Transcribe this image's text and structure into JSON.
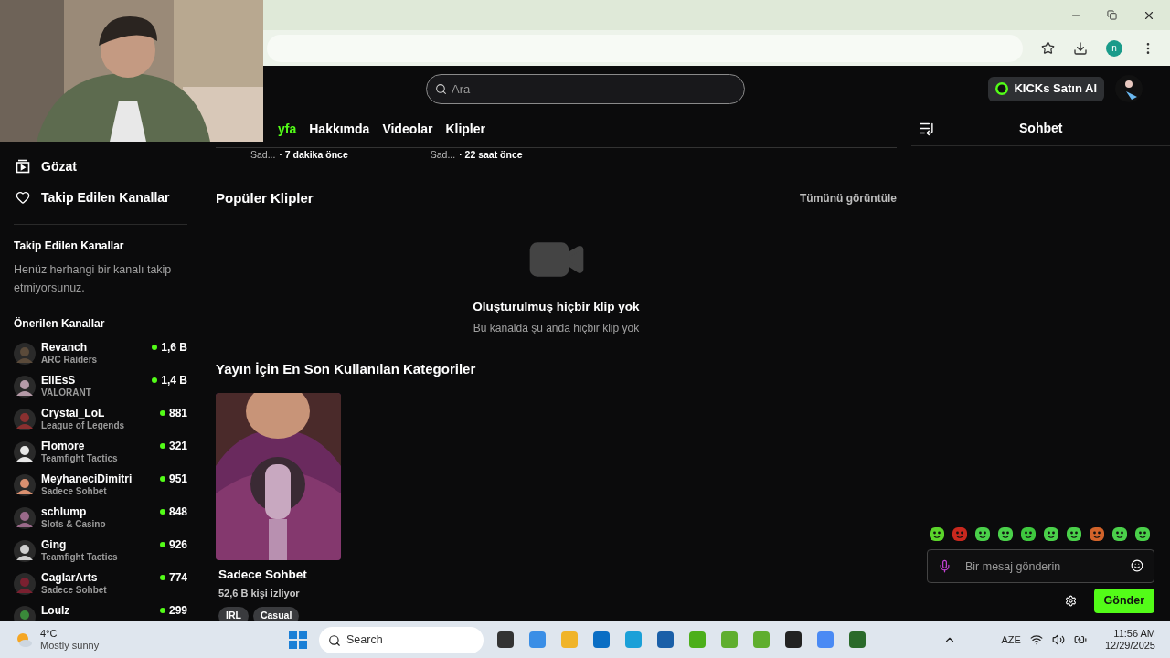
{
  "browser": {
    "profile_initial": "n"
  },
  "header": {
    "search_placeholder": "Ara",
    "buy_button": "KICKs Satın Al"
  },
  "sidebar": {
    "nav": [
      {
        "label": "Gözat"
      },
      {
        "label": "Takip Edilen Kanallar"
      }
    ],
    "followed": {
      "title": "Takip Edilen Kanallar",
      "empty_text": "Henüz herhangi bir kanalı takip etmiyorsunuz."
    },
    "recommended": {
      "title": "Önerilen Kanallar",
      "channels": [
        {
          "name": "Revanch",
          "category": "ARC Raiders",
          "viewers": "1,6 B"
        },
        {
          "name": "EliEsS",
          "category": "VALORANT",
          "viewers": "1,4 B"
        },
        {
          "name": "Crystal_LoL",
          "category": "League of Legends",
          "viewers": "881"
        },
        {
          "name": "Flomore",
          "category": "Teamfight Tactics",
          "viewers": "321"
        },
        {
          "name": "MeyhaneciDimitri",
          "category": "Sadece Sohbet",
          "viewers": "951"
        },
        {
          "name": "schlump",
          "category": "Slots & Casino",
          "viewers": "848"
        },
        {
          "name": "Ging",
          "category": "Teamfight Tactics",
          "viewers": "926"
        },
        {
          "name": "CaglarArts",
          "category": "Sadece Sohbet",
          "viewers": "774"
        },
        {
          "name": "Loulz",
          "viewers": "299"
        }
      ]
    }
  },
  "channel_tabs": [
    {
      "label": "yfa",
      "selected": true
    },
    {
      "label": "Hakkımda",
      "selected": false
    },
    {
      "label": "Videolar",
      "selected": false
    },
    {
      "label": "Klipler",
      "selected": false
    }
  ],
  "recent_streams": [
    {
      "category": "Sad...",
      "time": "· 7 dakika önce"
    },
    {
      "category": "Sad...",
      "time": "· 22 saat önce"
    }
  ],
  "clips": {
    "title": "Popüler Klipler",
    "view_all": "Tümünü görüntüle",
    "empty_title": "Oluşturulmuş hiçbir klip yok",
    "empty_text": "Bu kanalda şu anda hiçbir klip yok"
  },
  "categories": {
    "title": "Yayın İçin En Son Kullanılan Kategoriler",
    "items": [
      {
        "name": "Sadece Sohbet",
        "viewers": "52,6 B kişi izliyor",
        "tags": [
          "IRL",
          "Casual"
        ]
      }
    ]
  },
  "chat": {
    "title": "Sohbet",
    "placeholder": "Bir mesaj gönderin",
    "send_button": "Gönder"
  },
  "taskbar": {
    "weather_temp": "4°C",
    "weather_text": "Mostly sunny",
    "search_placeholder": "Search",
    "language": "AZE",
    "time": "11:56 AM",
    "date": "12/29/2025"
  }
}
